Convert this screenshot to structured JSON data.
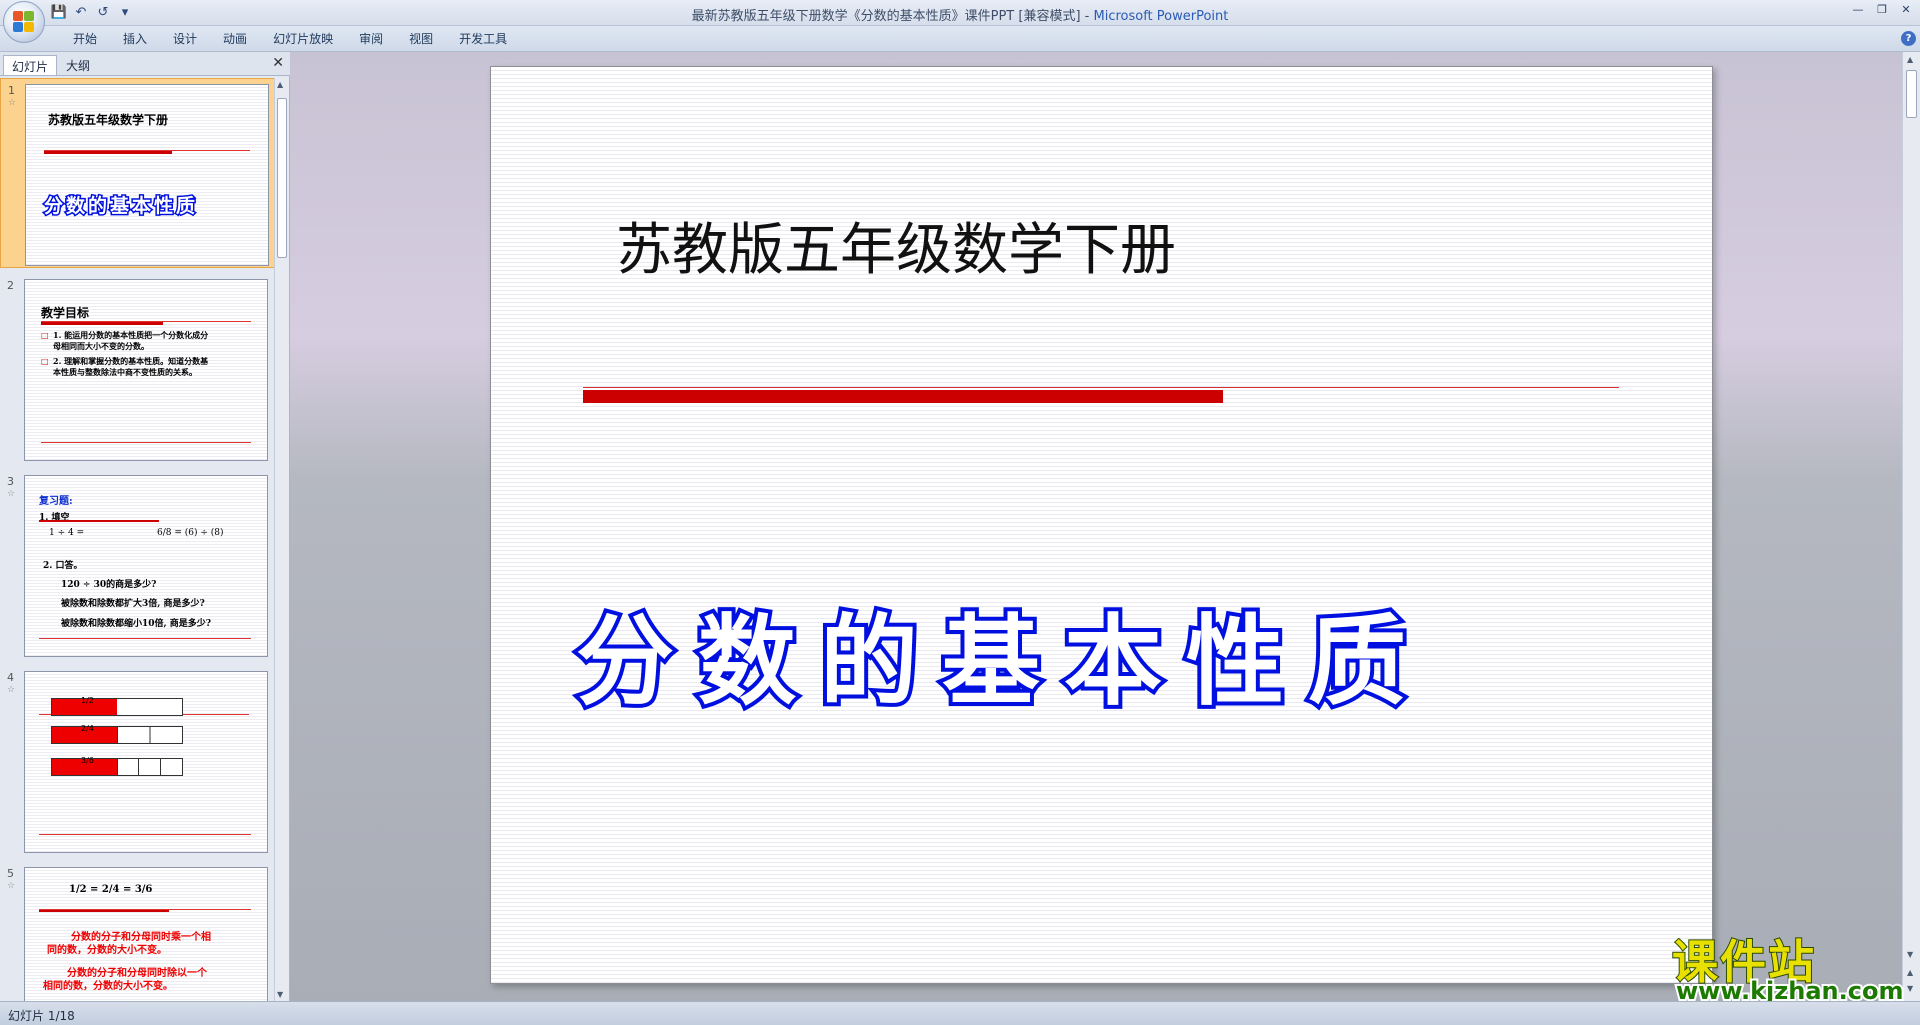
{
  "window": {
    "title": "最新苏教版五年级下册数学《分数的基本性质》课件PPT [兼容模式] - ",
    "app_name": "Microsoft PowerPoint"
  },
  "ribbon": {
    "tabs": [
      "开始",
      "插入",
      "设计",
      "动画",
      "幻灯片放映",
      "审阅",
      "视图",
      "开发工具"
    ]
  },
  "panel": {
    "tab_slides": "幻灯片",
    "tab_outline": "大纲",
    "thumbnails": [
      {
        "num": "1",
        "title": "苏教版五年级数学下册",
        "subtitle": "分数的基本性质"
      },
      {
        "num": "2",
        "title": "教学目标",
        "line1": "1. 能运用分数的基本性质把一个分数化成分",
        "line1b": "母相同而大小不变的分数。",
        "line2": "2. 理解和掌握分数的基本性质。知道分数基",
        "line2b": "本性质与整数除法中商不变性质的关系。"
      },
      {
        "num": "3",
        "title": "复习题:",
        "l1": "1. 填空",
        "l2": "1 ÷ 4 =",
        "l3": "6/8 = (6) ÷ (8)",
        "l4": "2. 口答。",
        "l5": "120 ÷ 30的商是多少?",
        "l6": "被除数和除数都扩大3倍, 商是多少?",
        "l7": "被除数和除数都缩小10倍, 商是多少?"
      },
      {
        "num": "4",
        "f1": "1/2",
        "f2": "2/4",
        "f3": "3/6"
      },
      {
        "num": "5",
        "eq": "1/2 = 2/4 = 3/6",
        "r1": "分数的分子和分母同时乘一个相",
        "r1b": "同的数，分数的大小不变。",
        "r2": "分数的分子和分母同时除以一个",
        "r2b": "相同的数，分数的大小不变。"
      }
    ]
  },
  "slide": {
    "title": "苏教版五年级数学下册",
    "subtitle": "分数的基本性质"
  },
  "status": {
    "slide_counter": "幻灯片 1/18"
  },
  "watermark": {
    "top": "课件站",
    "bottom": "www.kjzhan.com"
  }
}
